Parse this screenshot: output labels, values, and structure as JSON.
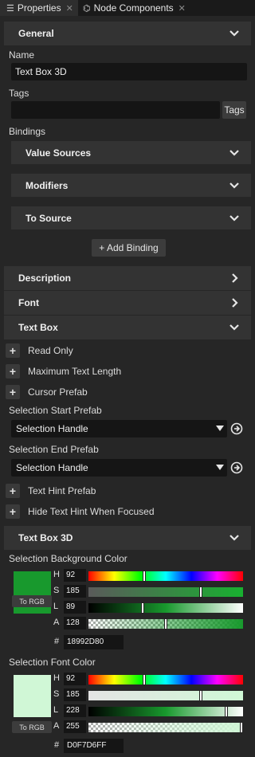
{
  "tabs": [
    {
      "label": "Properties",
      "icon": "list-icon",
      "active": true
    },
    {
      "label": "Node Components",
      "icon": "node-components-icon",
      "active": false
    }
  ],
  "general": {
    "title": "General",
    "name_label": "Name",
    "name_value": "Text Box 3D",
    "tags_label": "Tags",
    "tags_value": "",
    "tags_button": "Tags",
    "bindings_label": "Bindings",
    "binding_sections": [
      "Value Sources",
      "Modifiers",
      "To Source"
    ],
    "add_binding": "+ Add Binding"
  },
  "sections": {
    "description": "Description",
    "font": "Font",
    "textbox": "Text Box",
    "textbox3d": "Text Box 3D"
  },
  "textbox": {
    "plus_items": [
      "Read Only",
      "Maximum Text Length",
      "Cursor Prefab"
    ],
    "selection_start_label": "Selection Start Prefab",
    "selection_start_value": "Selection Handle",
    "selection_end_label": "Selection End Prefab",
    "selection_end_value": "Selection Handle",
    "plus_items2": [
      "Text Hint Prefab",
      "Hide Text Hint When Focused"
    ]
  },
  "textbox3d": {
    "colors": [
      {
        "label": "Selection Background Color",
        "swatch": "#18992D",
        "h": "92",
        "s": "185",
        "l": "89",
        "a": "128",
        "h_level": 0.361,
        "s_level": 0.725,
        "l_level": 0.349,
        "a_level": 0.502,
        "hex": "18992D80",
        "rgb_button": "To RGB"
      },
      {
        "label": "Selection Font Color",
        "swatch": "#D0F7D6",
        "h": "92",
        "s": "185",
        "l": "228",
        "a": "255",
        "h_level": 0.361,
        "s_level": 0.725,
        "l_level": 0.894,
        "a_level": 1.0,
        "hex": "D0F7D6FF",
        "rgb_button": "To RGB"
      }
    ],
    "channel_labels": [
      "H",
      "S",
      "L",
      "A"
    ],
    "hash": "#"
  }
}
